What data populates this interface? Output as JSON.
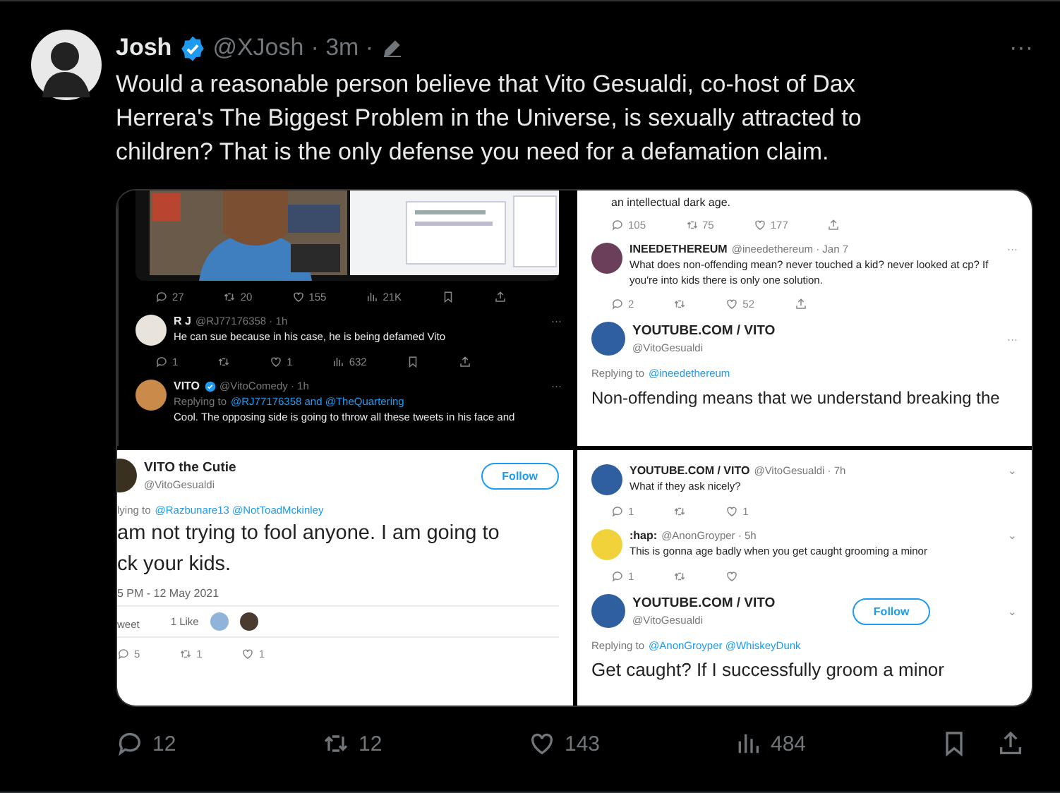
{
  "tweet": {
    "author": "Josh",
    "verified": true,
    "handle": "@XJosh",
    "time": "· 3m ·",
    "more": "···",
    "text": "Would a reasonable person believe that Vito Gesualdi, co-host of Dax Herrera's The Biggest Problem in the Universe, is sexually attracted to children? That is the only defense you need for a defamation claim."
  },
  "media": [
    {
      "blocks": [
        {
          "kind": "picture"
        },
        {
          "kind": "actions",
          "items": [
            {
              "kind": "reply",
              "count": "27"
            },
            {
              "kind": "retweet",
              "count": "20"
            },
            {
              "kind": "like",
              "count": "155"
            },
            {
              "kind": "views",
              "count": "21K"
            },
            {
              "kind": "bookmark"
            },
            {
              "kind": "share"
            }
          ]
        },
        {
          "kind": "reply",
          "name": "R J",
          "handle": "@RJ77176358 · 1h",
          "more": "···",
          "text": "He can sue because in his case, he is being defamed Vito"
        },
        {
          "kind": "actions",
          "items": [
            {
              "kind": "reply",
              "count": "1"
            },
            {
              "kind": "retweet"
            },
            {
              "kind": "like",
              "count": "1"
            },
            {
              "kind": "views",
              "count": "632"
            },
            {
              "kind": "bookmark"
            },
            {
              "kind": "share"
            }
          ]
        },
        {
          "kind": "reply",
          "name": "VITO",
          "verified": true,
          "handle": "@VitoComedy · 1h",
          "more": "···",
          "replying": "Replying to",
          "mentions": "@RJ77176358 and @TheQuartering",
          "text": "Cool. The opposing side is going to throw all these tweets in his face and"
        }
      ]
    },
    {
      "blocks": [
        {
          "kind": "text",
          "text": "an intellectual dark age."
        },
        {
          "kind": "actions",
          "items": [
            {
              "kind": "reply",
              "count": "105"
            },
            {
              "kind": "retweet",
              "count": "75"
            },
            {
              "kind": "like",
              "count": "177"
            },
            {
              "kind": "share"
            }
          ]
        },
        {
          "kind": "reply",
          "name": "INEEDETHEREUM",
          "handle": "@ineedethereum · Jan 7",
          "more": "···",
          "text": "What does non-offending mean? never touched a kid? never looked at cp? If you're into kids there is only one solution."
        },
        {
          "kind": "actions",
          "items": [
            {
              "kind": "reply",
              "count": "2"
            },
            {
              "kind": "retweet"
            },
            {
              "kind": "like",
              "count": "52"
            },
            {
              "kind": "share"
            }
          ]
        },
        {
          "kind": "profile",
          "name": "YOUTUBE.COM / VITO",
          "handle": "@VitoGesualdi",
          "more": "···",
          "replying": "Replying to",
          "mentions": "@ineedethereum",
          "lines": [
            "Non-offending means that we understand breaking the"
          ]
        }
      ]
    },
    {
      "blocks": [
        {
          "kind": "profile",
          "name": "VITO the Cutie",
          "handle": "@VitoGesualdi",
          "follow": "Follow",
          "replying": "lying to",
          "mentions": "@Razbunare13 @NotToadMckinley",
          "lines": [
            "am not trying to fool anyone. I am going to",
            "ck your kids."
          ]
        },
        {
          "kind": "text",
          "text": "5 PM - 12 May 2021"
        },
        {
          "kind": "likes",
          "label": "weet",
          "count": "1 Like"
        },
        {
          "kind": "actions",
          "items": [
            {
              "kind": "reply",
              "count": "5"
            },
            {
              "kind": "retweet",
              "count": "1"
            },
            {
              "kind": "like",
              "count": "1"
            }
          ]
        }
      ]
    },
    {
      "blocks": [
        {
          "kind": "reply",
          "name": "YOUTUBE.COM / VITO",
          "handle": "@VitoGesualdi · 7h",
          "chevron": "⌄",
          "text": "What if they ask nicely?"
        },
        {
          "kind": "actions",
          "items": [
            {
              "kind": "reply",
              "count": "1"
            },
            {
              "kind": "retweet"
            },
            {
              "kind": "like",
              "count": "1"
            }
          ]
        },
        {
          "kind": "reply",
          "name": ":hap:",
          "handle": "@AnonGroyper · 5h",
          "chevron": "⌄",
          "text": "This is gonna age badly when you get caught grooming a minor"
        },
        {
          "kind": "actions",
          "items": [
            {
              "kind": "reply",
              "count": "1"
            },
            {
              "kind": "retweet"
            },
            {
              "kind": "like"
            }
          ]
        },
        {
          "kind": "profile",
          "name": "YOUTUBE.COM / VITO",
          "handle": "@VitoGesualdi",
          "follow": "Follow",
          "chevron": "⌄",
          "replying": "Replying to",
          "mentions": "@AnonGroyper @WhiskeyDunk",
          "lines": [
            "Get caught? If I successfully groom a minor"
          ]
        }
      ]
    }
  ],
  "actions": [
    {
      "kind": "reply",
      "count": "12"
    },
    {
      "kind": "retweet",
      "count": "12"
    },
    {
      "kind": "like",
      "count": "143"
    },
    {
      "kind": "views",
      "count": "484"
    },
    {
      "kind": "bookmark"
    },
    {
      "kind": "share"
    }
  ]
}
